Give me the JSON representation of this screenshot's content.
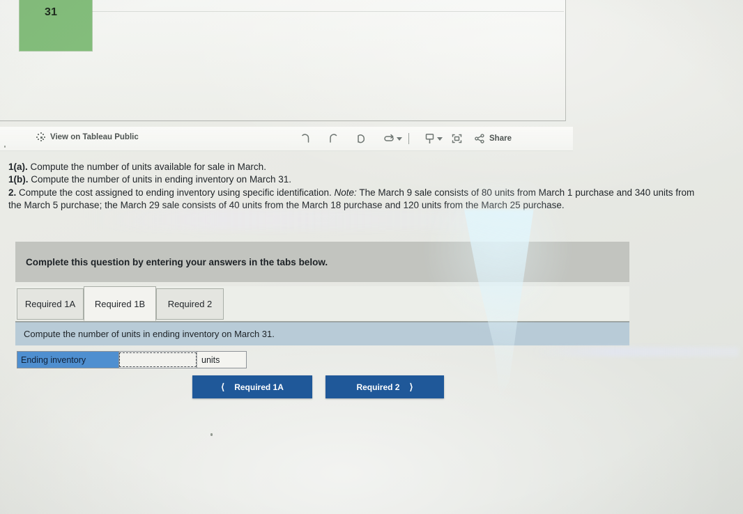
{
  "viz": {
    "cell_value": "31",
    "cell_color": "#83bd7b"
  },
  "toolbar": {
    "public_link_label": "View on Tableau Public",
    "tableau_logo_icon": "tableau-logo-icon",
    "undo_icon": "undo-icon",
    "redo_icon": "redo-icon",
    "revert_icon": "revert-icon",
    "refresh_icon": "refresh-icon",
    "refresh_caret_icon": "chevron-down-icon",
    "download_icon": "download-icon",
    "download_caret_icon": "chevron-down-icon",
    "fullscreen_icon": "fullscreen-icon",
    "share_icon": "share-icon",
    "share_label": "Share"
  },
  "question": {
    "line1_label": "1(a).",
    "line1_text": " Compute the number of units available for sale in March.",
    "line2_label": "1(b).",
    "line2_text": " Compute the number of units in ending inventory on March 31.",
    "line3_label": "2.",
    "line3_text_a": " Compute the cost assigned to ending inventory using specific identification. ",
    "line3_note_label": "Note:",
    "line3_text_b": " The March 9 sale consists of 80 units from March 1 purchase and 340 units from the March 5 purchase; the March 29 sale consists of 40 units from the March 18 purchase and 120 units from the March 25 purchase."
  },
  "answer_panel": {
    "header": "Complete this question by entering your answers in the tabs below.",
    "tabs": [
      {
        "label": "Required 1A",
        "active": false
      },
      {
        "label": "Required 1B",
        "active": true
      },
      {
        "label": "Required 2",
        "active": false
      }
    ],
    "requirement_instruction": "Compute the number of units in ending inventory on March 31.",
    "row": {
      "label": "Ending inventory",
      "input_value": "",
      "input_placeholder": "",
      "units_label": "units"
    },
    "nav": {
      "prev_label": "Required 1A",
      "prev_icon": "chevron-left-icon",
      "next_label": "Required 2",
      "next_icon": "chevron-right-icon"
    },
    "colors": {
      "header_bg": "#c2c4bf",
      "instruction_bg": "#b8cbd7",
      "row_label_bg": "#4f8fd0",
      "nav_button_bg": "#1f5899"
    }
  }
}
